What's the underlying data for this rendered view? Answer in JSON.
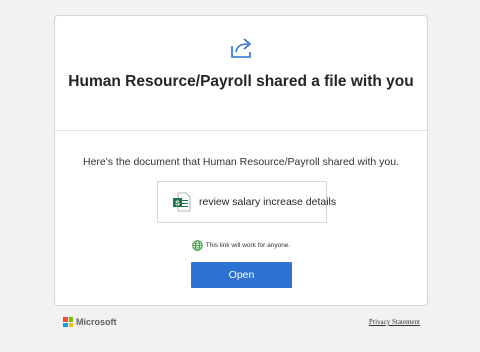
{
  "header": {
    "title": "Human Resource/Payroll shared a file with you"
  },
  "body": {
    "intro": "Here's the document that Human Resource/Payroll shared with you.",
    "file": {
      "name": "review salary increase details",
      "icon": "excel-file-icon"
    },
    "note": "This link will work for anyone.",
    "open_label": "Open"
  },
  "footer": {
    "brand": "Microsoft",
    "privacy_label": "Privacy Statement"
  },
  "colors": {
    "accent": "#2b72d3",
    "background": "#f2f2f2",
    "excel_green": "#1e7145",
    "ms_red": "#f25022",
    "ms_green": "#7fba00",
    "ms_blue": "#00a4ef",
    "ms_yellow": "#ffb900"
  }
}
